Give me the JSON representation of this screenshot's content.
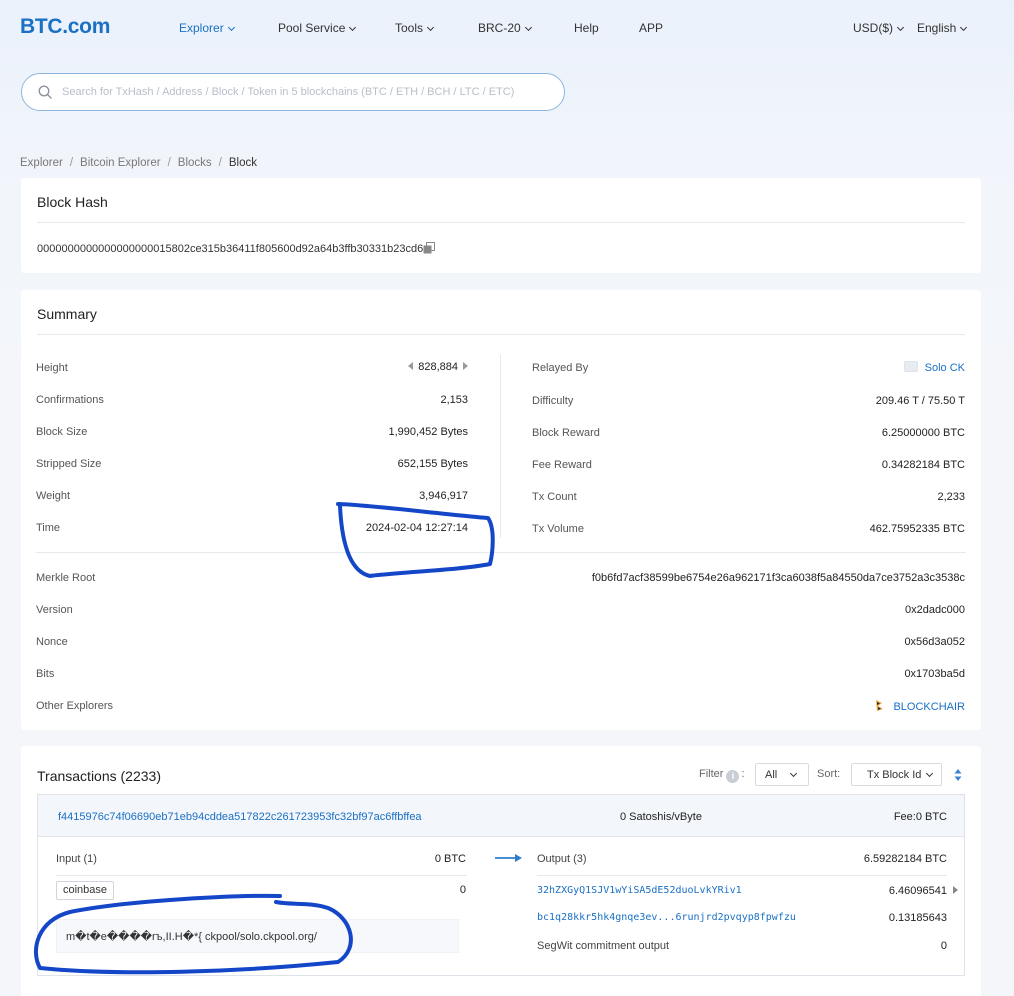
{
  "header": {
    "logo": "BTC.com",
    "nav": [
      {
        "label": "Explorer",
        "active": true,
        "dropdown": true
      },
      {
        "label": "Pool Service",
        "dropdown": true
      },
      {
        "label": "Tools",
        "dropdown": true
      },
      {
        "label": "BRC-20",
        "dropdown": true
      },
      {
        "label": "Help",
        "dropdown": false
      },
      {
        "label": "APP",
        "dropdown": false
      }
    ],
    "currency": "USD($)",
    "language": "English"
  },
  "search": {
    "placeholder": "Search for TxHash / Address / Block / Token in 5 blockchains (BTC / ETH / BCH / LTC / ETC)",
    "value": ""
  },
  "breadcrumb": [
    "Explorer",
    "Bitcoin Explorer",
    "Blocks",
    "Block"
  ],
  "block_hash": {
    "title": "Block Hash",
    "value": "0000000000000000000015802ce315b36411f805600d92a64b3ffb30331b23cd6"
  },
  "summary": {
    "title": "Summary",
    "left": [
      {
        "label": "Height",
        "value": "828,884"
      },
      {
        "label": "Confirmations",
        "value": "2,153"
      },
      {
        "label": "Block Size",
        "value": "1,990,452 Bytes"
      },
      {
        "label": "Stripped Size",
        "value": "652,155 Bytes"
      },
      {
        "label": "Weight",
        "value": "3,946,917"
      },
      {
        "label": "Time",
        "value": "2024-02-04 12:27:14"
      }
    ],
    "right": [
      {
        "label": "Relayed By",
        "value": "Solo CK"
      },
      {
        "label": "Difficulty",
        "value": "209.46 T / 75.50 T"
      },
      {
        "label": "Block Reward",
        "value": "6.25000000 BTC"
      },
      {
        "label": "Fee Reward",
        "value": "0.34282184 BTC"
      },
      {
        "label": "Tx Count",
        "value": "2,233"
      },
      {
        "label": "Tx Volume",
        "value": "462.75952335 BTC"
      }
    ],
    "full": [
      {
        "label": "Merkle Root",
        "value": "f0b6fd7acf38599be6754e26a962171f3ca6038f5a84550da7ce3752a3c3538c"
      },
      {
        "label": "Version",
        "value": "0x2dadc000"
      },
      {
        "label": "Nonce",
        "value": "0x56d3a052"
      },
      {
        "label": "Bits",
        "value": "0x1703ba5d"
      },
      {
        "label": "Other Explorers",
        "value": "BLOCKCHAIR"
      }
    ]
  },
  "transactions": {
    "title": "Transactions (2233)",
    "filter_label": "Filter",
    "filter_value": "All",
    "sort_label": "Sort:",
    "sort_value": "Tx Block Id",
    "tx": {
      "id": "f4415976c74f06690eb71eb94cddea517822c261723953fc32bf97ac6ffbffea",
      "rate": "0 Satoshis/vByte",
      "fee": "Fee:0 BTC",
      "input_label": "Input (1)",
      "input_total": "0 BTC",
      "coinbase_tag": "coinbase",
      "coinbase_value": "0",
      "coinbase_script": "m�t�e����rъ,II.H�*{ ckpool/solo.ckpool.org/",
      "output_label": "Output (3)",
      "output_total": "6.59282184 BTC",
      "outputs": [
        {
          "address": "32hZXGyQ1SJV1wYiSA5dE52duoLvkYRiv1",
          "value": "6.46096541"
        },
        {
          "address": "bc1q28kkr5hk4gnqe3ev...6runjrd2pvqyp8fpwfzu",
          "value": "0.13185643"
        },
        {
          "address": "SegWit commitment output",
          "value": "0"
        }
      ]
    }
  },
  "colors": {
    "brand": "#1a70c4",
    "annotation": "#1446c8"
  }
}
